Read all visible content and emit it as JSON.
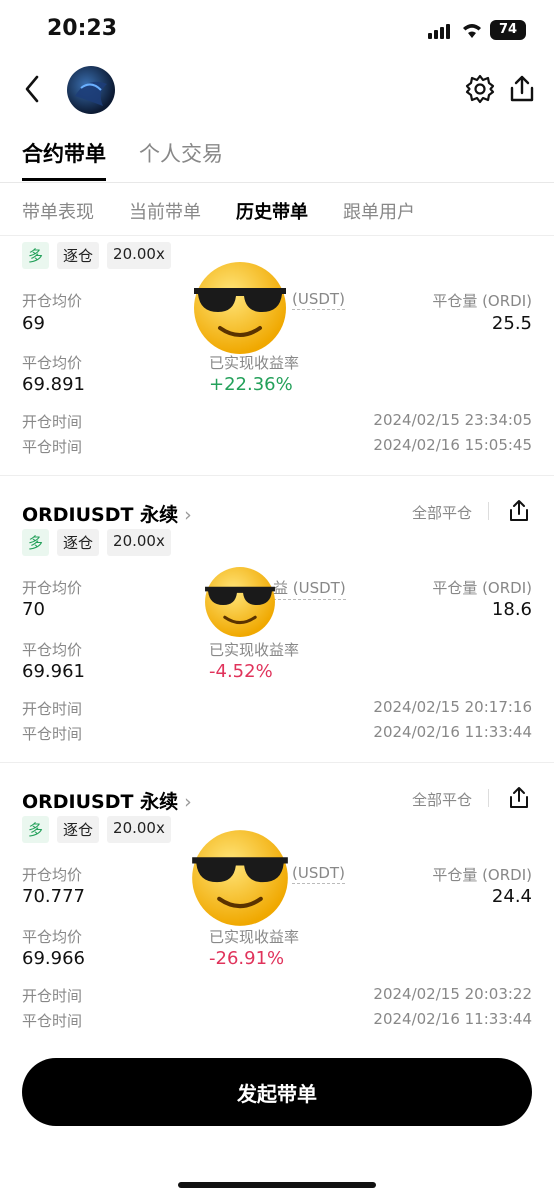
{
  "status": {
    "time": "20:23",
    "battery": "74"
  },
  "main_tabs": [
    "合约带单",
    "个人交易"
  ],
  "sub_tabs": [
    "带单表现",
    "当前带单",
    "历史带单",
    "跟单用户"
  ],
  "labels": {
    "open_avg": "开仓均价",
    "close_avg": "平仓均价",
    "close_qty": "平仓量 (ORDI)",
    "pnl_usdt_partial": "(USDT)",
    "pnl_usdt_partial2": "益 (USDT)",
    "realized_rate": "已实现收益率",
    "open_time": "开仓时间",
    "close_time": "平仓时间",
    "close_all": "全部平仓"
  },
  "cards": [
    {
      "title": "",
      "tags": [
        "多",
        "逐仓",
        "20.00x"
      ],
      "open_avg": "69",
      "close_qty": "25.5",
      "close_avg": "69.891",
      "rate": "+22.36%",
      "open_time": "2024/02/15 23:34:05",
      "close_time": "2024/02/16 15:05:45"
    },
    {
      "title": "ORDIUSDT 永续",
      "tags": [
        "多",
        "逐仓",
        "20.00x"
      ],
      "open_avg": "70",
      "close_qty": "18.6",
      "close_avg": "69.961",
      "rate": "-4.52%",
      "open_time": "2024/02/15 20:17:16",
      "close_time": "2024/02/16 11:33:44"
    },
    {
      "title": "ORDIUSDT 永续",
      "tags": [
        "多",
        "逐仓",
        "20.00x"
      ],
      "open_avg": "70.777",
      "close_qty": "24.4",
      "close_avg": "69.966",
      "rate": "-26.91%",
      "open_time": "2024/02/15 20:03:22",
      "close_time": "2024/02/16 11:33:44"
    }
  ],
  "cta": "发起带单",
  "colors": {
    "positive": "#23a05a",
    "negative": "#e0335b",
    "tag_green": "#23a05a"
  }
}
